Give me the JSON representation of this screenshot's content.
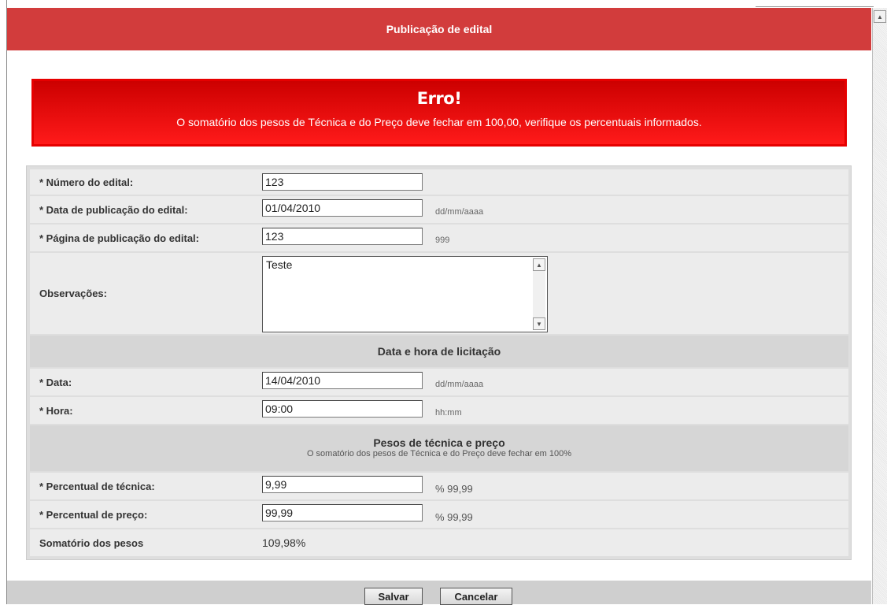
{
  "window": {
    "title": "Publicação de edital"
  },
  "error": {
    "title": "Erro!",
    "message": "O somatório dos pesos de Técnica e do Preço deve fechar em 100,00, verifique os percentuais informados."
  },
  "form": {
    "numero": {
      "label": "* Número do edital:",
      "value": "123"
    },
    "data_publicacao": {
      "label": "* Data de publicação do edital:",
      "value": "01/04/2010",
      "hint": "dd/mm/aaaa"
    },
    "pagina": {
      "label": "* Página de publicação do edital:",
      "value": "123",
      "hint": "999"
    },
    "observacoes": {
      "label": "Observações:",
      "value": "Teste"
    },
    "section_licitacao": {
      "title": "Data e hora de licitação"
    },
    "data": {
      "label": "* Data:",
      "value": "14/04/2010",
      "hint": "dd/mm/aaaa"
    },
    "hora": {
      "label": "* Hora:",
      "value": "09:00",
      "hint": "hh:mm"
    },
    "section_pesos": {
      "title": "Pesos de técnica e preço",
      "subtitle": "O somatório dos pesos de Técnica e do Preço deve fechar em 100%"
    },
    "perc_tecnica": {
      "label": "* Percentual de técnica:",
      "value": "9,99",
      "hint": "% 99,99"
    },
    "perc_preco": {
      "label": "* Percentual de preço:",
      "value": "99,99",
      "hint": "% 99,99"
    },
    "somatorio": {
      "label": "Somatório dos pesos",
      "value": "109,98%"
    }
  },
  "footer": {
    "save_label": "Salvar",
    "cancel_label": "Cancelar"
  },
  "colors": {
    "titlebar": "#d23c3c",
    "error_bg": "#e60000"
  }
}
